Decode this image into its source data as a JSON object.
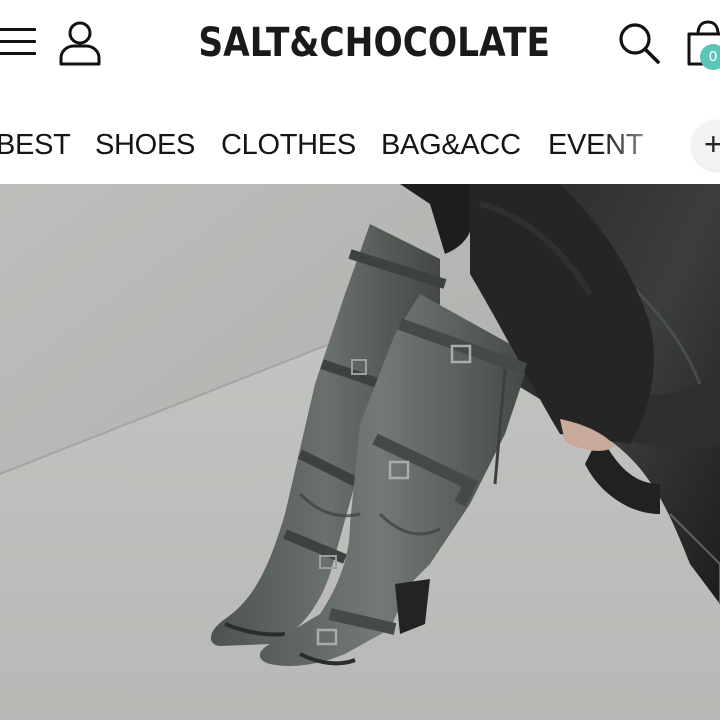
{
  "header": {
    "brand": "SALT&CHOCOLATE",
    "menu_icon": "hamburger-menu-icon",
    "account_icon": "user-account-icon",
    "search_icon": "search-icon",
    "cart_icon": "shopping-bag-icon",
    "cart_count": "0"
  },
  "nav": {
    "items": [
      {
        "label": "BEST"
      },
      {
        "label": "SHOES"
      },
      {
        "label": "CLOTHES"
      },
      {
        "label": "BAG&ACC"
      },
      {
        "label": "EVENT"
      }
    ],
    "more_icon": "plus-icon",
    "more_label": "+"
  },
  "hero": {
    "image": "knee-high-buckle-boots-photo"
  },
  "colors": {
    "text": "#111111",
    "badge": "#5cc6b6",
    "background": "#ffffff"
  }
}
